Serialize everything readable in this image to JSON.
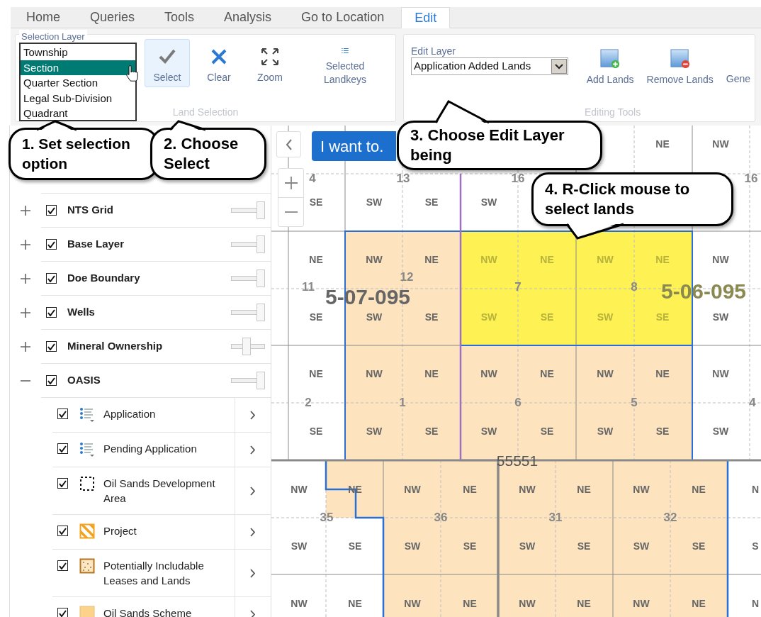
{
  "tabs": [
    {
      "label": "Home",
      "selected": false
    },
    {
      "label": "Queries",
      "selected": false
    },
    {
      "label": "Tools",
      "selected": false
    },
    {
      "label": "Analysis",
      "selected": false
    },
    {
      "label": "Go to Location",
      "selected": false
    },
    {
      "label": "Edit",
      "selected": true
    }
  ],
  "ribbon": {
    "selection_layer": {
      "label": "Selection Layer",
      "options": [
        {
          "label": "Township",
          "selected": false
        },
        {
          "label": "Section",
          "selected": true
        },
        {
          "label": "Quarter Section",
          "selected": false
        },
        {
          "label": "Legal Sub-Division",
          "selected": false
        },
        {
          "label": "Quadrant",
          "selected": false
        }
      ]
    },
    "land_selection": {
      "title": "Land Selection",
      "buttons": [
        {
          "kind": "check",
          "label": "Select",
          "selected": true
        },
        {
          "kind": "clear",
          "label": "Clear",
          "selected": false
        },
        {
          "kind": "zoom",
          "label": "Zoom",
          "selected": false
        },
        {
          "kind": "list",
          "label": "Selected Landkeys",
          "selected": false
        }
      ]
    },
    "editing_tools": {
      "title": "Editing Tools",
      "edit_layer": {
        "label": "Edit Layer",
        "value": "Application Added Lands"
      },
      "buttons": [
        {
          "kind": "add",
          "label": "Add Lands"
        },
        {
          "kind": "remove",
          "label": "Remove Lands"
        },
        {
          "kind": "text",
          "label": "Gene"
        }
      ]
    }
  },
  "layers": [
    {
      "name": "NTS Grid",
      "expanded": false,
      "checked": true,
      "level": 1
    },
    {
      "name": "Base Layer",
      "expanded": false,
      "checked": true,
      "level": 1
    },
    {
      "name": "Doe Boundary",
      "expanded": false,
      "checked": true,
      "level": 1
    },
    {
      "name": "Wells",
      "expanded": false,
      "checked": true,
      "level": 1
    },
    {
      "name": "Mineral Ownership",
      "expanded": false,
      "checked": true,
      "level": 0.45
    },
    {
      "name": "OASIS",
      "expanded": true,
      "checked": true,
      "level": 1,
      "children": [
        {
          "name": "Application",
          "kind": "list",
          "checked": true
        },
        {
          "name": "Pending Application",
          "kind": "list",
          "checked": true
        },
        {
          "name": "Oil Sands Development Area",
          "kind": "dashed",
          "checked": true
        },
        {
          "name": "Project",
          "kind": "hatched",
          "checked": true
        },
        {
          "name": "Potentially Includable Leases and Lands",
          "kind": "dotted",
          "checked": true
        },
        {
          "name": "Oil Sands Scheme",
          "kind": "solid",
          "checked": true
        }
      ]
    }
  ],
  "map": {
    "action_button": "I want to.",
    "upper_grid": [
      {
        "cells": [
          {
            "kind": "plain"
          },
          {
            "kind": "plain"
          },
          {
            "kind": "plain"
          },
          {
            "kind": "plain"
          },
          {
            "kind": "plain"
          },
          {
            "kind": "plain"
          },
          {
            "kind": "plain",
            "text": "NE"
          },
          {
            "kind": "plain",
            "text": "NW"
          }
        ]
      },
      {
        "cells": [
          {
            "kind": "plain",
            "text": "SE"
          },
          {
            "kind": "plain",
            "text": "SW"
          },
          {
            "kind": "plain",
            "text": "SE"
          },
          {
            "kind": "plain",
            "text": "SW"
          },
          {
            "kind": "plain"
          },
          {
            "kind": "plain"
          },
          {
            "kind": "plain"
          },
          {
            "kind": "plain"
          }
        ]
      },
      {
        "cells": [
          {
            "kind": "plain",
            "text": "NE"
          },
          {
            "kind": "scheme",
            "text": "NW"
          },
          {
            "kind": "scheme",
            "text": "NE"
          },
          {
            "kind": "selected",
            "text": "NW"
          },
          {
            "kind": "selected",
            "text": "NE"
          },
          {
            "kind": "selected",
            "text": "NW"
          },
          {
            "kind": "selected",
            "text": "NE"
          },
          {
            "kind": "plain",
            "text": "NW"
          }
        ]
      },
      {
        "cells": [
          {
            "kind": "plain",
            "text": "SE"
          },
          {
            "kind": "scheme",
            "text": "SW"
          },
          {
            "kind": "scheme",
            "text": "SE"
          },
          {
            "kind": "selected",
            "text": "SW"
          },
          {
            "kind": "selected",
            "text": "SE"
          },
          {
            "kind": "selected",
            "text": "SW"
          },
          {
            "kind": "selected",
            "text": "SE"
          },
          {
            "kind": "plain",
            "text": "SW"
          }
        ]
      },
      {
        "cells": [
          {
            "kind": "plain",
            "text": "NE"
          },
          {
            "kind": "scheme",
            "text": "NW"
          },
          {
            "kind": "scheme",
            "text": "NE"
          },
          {
            "kind": "scheme",
            "text": "NW"
          },
          {
            "kind": "scheme",
            "text": "NE"
          },
          {
            "kind": "scheme",
            "text": "NW"
          },
          {
            "kind": "scheme",
            "text": "NE"
          },
          {
            "kind": "plain",
            "text": "NW"
          }
        ]
      },
      {
        "cells": [
          {
            "kind": "plain",
            "text": "SE"
          },
          {
            "kind": "scheme",
            "text": "SW"
          },
          {
            "kind": "scheme",
            "text": "SE"
          },
          {
            "kind": "scheme",
            "text": "SW"
          },
          {
            "kind": "scheme",
            "text": "SE"
          },
          {
            "kind": "scheme",
            "text": "SW"
          },
          {
            "kind": "scheme",
            "text": "SE"
          },
          {
            "kind": "plain",
            "text": "SW"
          }
        ]
      }
    ],
    "lower_grid": [
      {
        "cells": [
          {
            "kind": "plain",
            "text": "NW"
          },
          {
            "kind": "scheme",
            "text": "NE"
          },
          {
            "kind": "scheme",
            "text": "NW"
          },
          {
            "kind": "scheme",
            "text": "NE"
          },
          {
            "kind": "scheme",
            "text": "NW"
          },
          {
            "kind": "scheme",
            "text": "NE"
          },
          {
            "kind": "scheme",
            "text": "NW"
          },
          {
            "kind": "scheme",
            "text": "NE"
          },
          {
            "kind": "plain",
            "text": "N"
          }
        ]
      },
      {
        "cells": [
          {
            "kind": "plain",
            "text": "SW"
          },
          {
            "kind": "plain",
            "text": "SE"
          },
          {
            "kind": "scheme",
            "text": "SW"
          },
          {
            "kind": "scheme",
            "text": "SE"
          },
          {
            "kind": "scheme",
            "text": "SW"
          },
          {
            "kind": "scheme",
            "text": "SE"
          },
          {
            "kind": "scheme",
            "text": "SW"
          },
          {
            "kind": "scheme",
            "text": "SE"
          },
          {
            "kind": "plain",
            "text": "S"
          }
        ]
      },
      {
        "cells": [
          {
            "kind": "plain",
            "text": "NW"
          },
          {
            "kind": "plain",
            "text": "NE"
          },
          {
            "kind": "scheme",
            "text": "NW"
          },
          {
            "kind": "scheme",
            "text": "NE"
          },
          {
            "kind": "scheme",
            "text": "NW"
          },
          {
            "kind": "scheme",
            "text": "NE"
          },
          {
            "kind": "scheme",
            "text": "NW"
          },
          {
            "kind": "scheme",
            "text": "NE"
          },
          {
            "kind": "plain",
            "text": "N"
          }
        ]
      }
    ],
    "section_numbers": [
      "4",
      "13",
      "16",
      "16",
      "12",
      "11",
      "7",
      "8",
      "2",
      "1",
      "6",
      "5",
      "4",
      "35",
      "36",
      "31",
      "32"
    ],
    "township_labels": [
      "5-07-095",
      "5-06-095"
    ],
    "boundary_label": "55551"
  },
  "callouts": [
    {
      "text": "1. Set selection option"
    },
    {
      "text": "2. Choose Select"
    },
    {
      "text": "3. Choose Edit Layer being"
    },
    {
      "text": "4. R-Click mouse to select lands"
    }
  ]
}
